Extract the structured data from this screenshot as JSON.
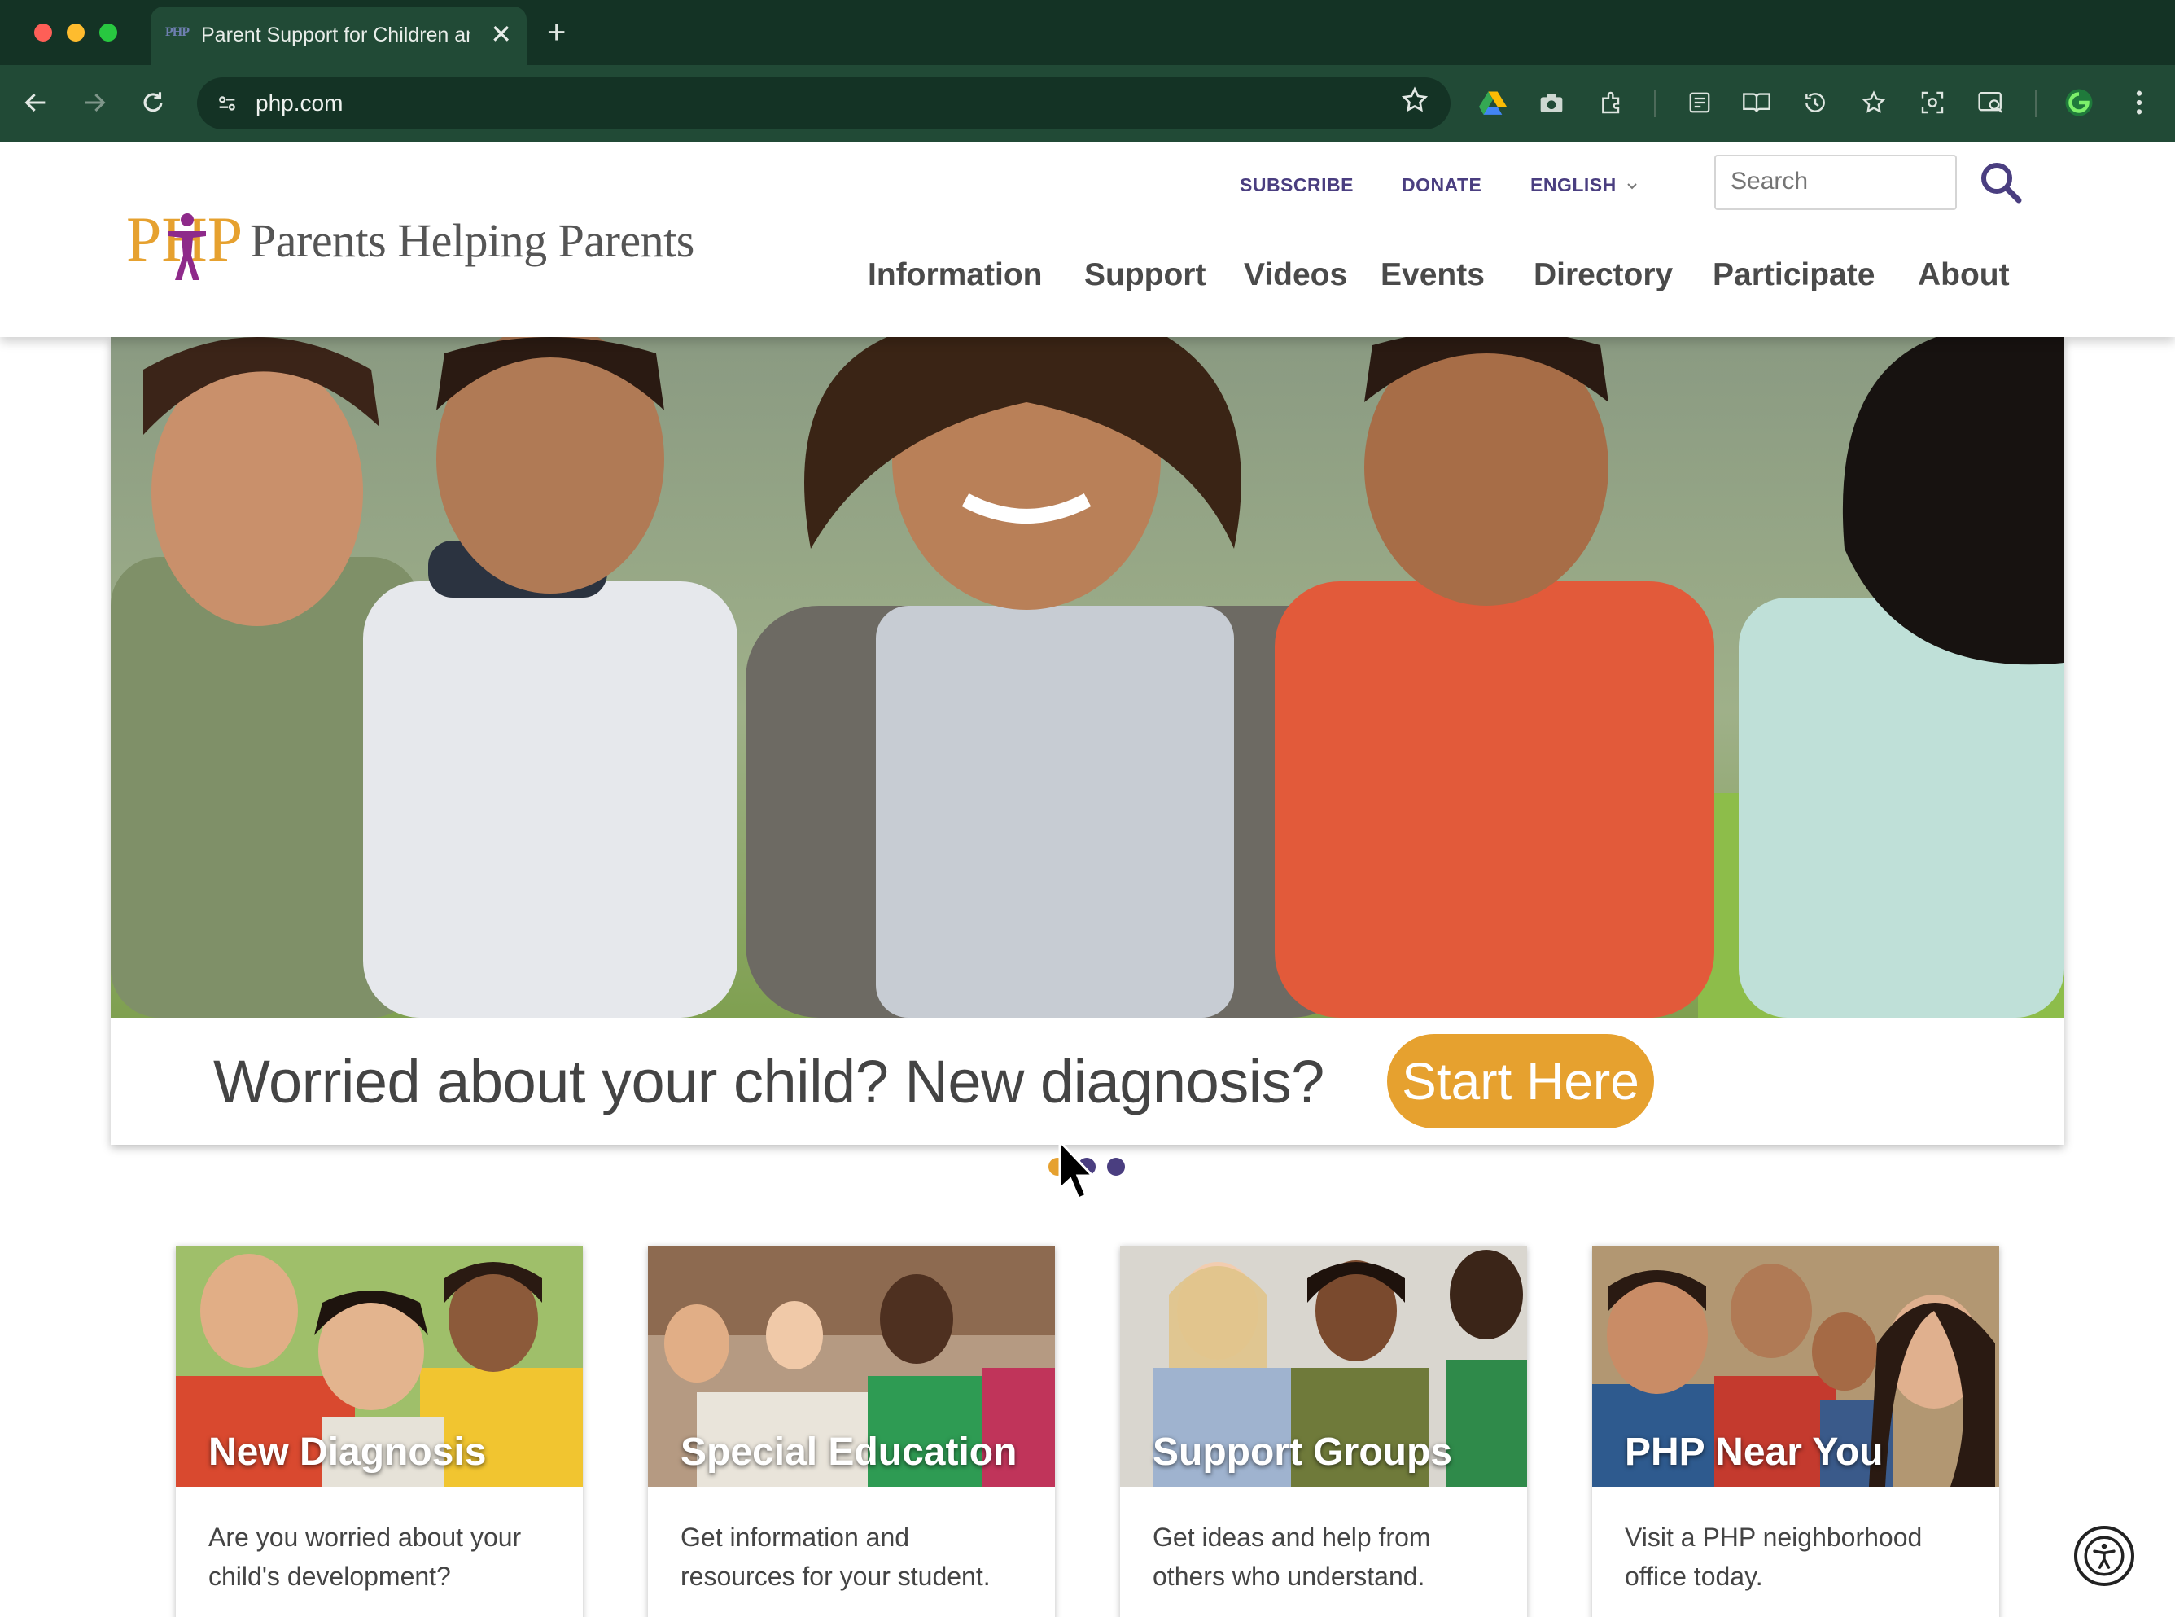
{
  "browser": {
    "tab_title": "Parent Support for Children and Families",
    "tab_favicon_text": "PHP",
    "close_glyph": "✕",
    "newtab_glyph": "+",
    "url": "php.com"
  },
  "site": {
    "logo_text": "Parents Helping Parents",
    "logo_letters": "PHP",
    "utility": {
      "subscribe": "SUBSCRIBE",
      "donate": "DONATE",
      "language": "ENGLISH"
    },
    "search_placeholder": "Search",
    "nav": [
      "Information",
      "Support",
      "Videos",
      "Events",
      "Directory",
      "Participate",
      "About"
    ],
    "colors": {
      "brand_purple": "#4a3e80",
      "brand_orange": "#e6a12f",
      "logo_magenta": "#8e2a8a"
    }
  },
  "hero": {
    "caption": "Worried about your child? New diagnosis?",
    "cta": "Start Here",
    "slides": 3,
    "active_slide": 1
  },
  "cards": [
    {
      "title": "New Diagnosis",
      "desc": "Are you worried about your child's development?"
    },
    {
      "title": "Special Education",
      "desc": "Get information and resources for your student."
    },
    {
      "title": "Support Groups",
      "desc": "Get ideas and help from others who understand."
    },
    {
      "title": "PHP Near You",
      "desc": "Visit a PHP neighborhood office today."
    }
  ]
}
